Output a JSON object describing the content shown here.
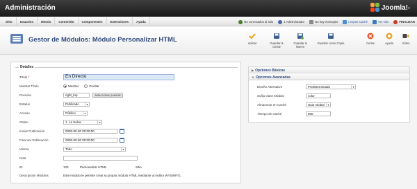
{
  "app": {
    "title": "Administración",
    "brand": "Joomla!",
    "brand_tm": "®"
  },
  "menu": [
    "Sitio",
    "Usuarios",
    "Menús",
    "Contenido",
    "Componentes",
    "Extensiones",
    "Ayuda"
  ],
  "status": [
    {
      "label": "No conectados al sitio",
      "icon": "visitors-icon",
      "color": "#4a7a2a"
    },
    {
      "label": "1 Administrador",
      "icon": "admins-icon",
      "color": "#4a6aa5"
    },
    {
      "label": "No hay mensajes",
      "icon": "messages-icon",
      "color": "#888888"
    },
    {
      "label": "Limpiar Caché",
      "icon": "cache-icon",
      "color": "#4b8fd4"
    },
    {
      "label": "Ver sitio",
      "icon": "view-site-icon",
      "color": "#3a7ac0"
    },
    {
      "label": "FINALIZAR",
      "icon": "logout-icon",
      "color": "#c53a2a"
    }
  ],
  "page_title": "Gestor de Módulos: Módulo Personalizar HTML",
  "toolbar": {
    "apply": "Aplicar",
    "save_close": "Guardar & Cerrar",
    "save_new": "Guardar & Nuevo",
    "save_copy": "Guardar como Copia",
    "close": "Cerrar",
    "help": "Ayuda",
    "video": "Vídeo"
  },
  "details": {
    "legend": "Detalles",
    "title_label": "Título",
    "title_required": "*",
    "title_value": "En Directo",
    "show_title_label": "Mostrar Título",
    "show_title_options": [
      "Mostrar",
      "Ocultar"
    ],
    "position_label": "Posición",
    "position_value": "right_top",
    "position_button": "Seleccionar posición",
    "status_label": "Estatus",
    "status_value": "Publicado",
    "access_label": "Acceso",
    "access_value": "Público",
    "order_label": "Orden",
    "order_value": "1. La Selva",
    "start_label": "Iniciar Publicación",
    "start_value": "0000-00-00 00:00:00",
    "finish_label": "Final ser Publicación",
    "finish_value": "0000-00-00 00:00:00",
    "language_label": "Idioma",
    "language_value": "Todo",
    "note_label": "Nota",
    "note_value": "",
    "id_label": "ID",
    "id_value": "120",
    "module_name": "Personalizar HTML",
    "site_label": "Sitio",
    "desc_label": "Descripción Módulos",
    "desc_value": "Este módulo le permite crear su propio módulo HTML mediante un editor WYSIWYG."
  },
  "options": {
    "basic_label": "Opciones Básicas",
    "advanced_label": "Opciones Avanzadas",
    "layout_label": "Diseño Alternativo",
    "layout_value": "Predeterminado",
    "suffix_label": "Sufijo clase Módulo",
    "suffix_value": "color",
    "cache_label": "Almacenar en Caché",
    "cache_value": "Usar Global",
    "cache_time_label": "Tiempo de Caché",
    "cache_time_value": "900"
  }
}
